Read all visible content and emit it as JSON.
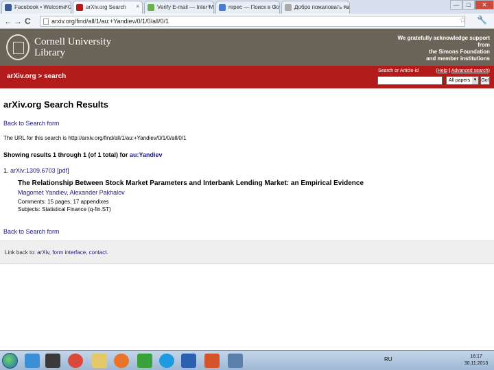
{
  "browser": {
    "tabs": [
      {
        "label": "Facebook • Welcome Google",
        "icon_color": "#3b5998"
      },
      {
        "label": "arXiv.org Search",
        "icon_color": "#b31b1b",
        "active": true
      },
      {
        "label": "Verify E-mail — Inter Medi",
        "icon_color": "#6ab04c"
      },
      {
        "label": "repec — Поиск в Google",
        "icon_color": "#4a7bd0"
      },
      {
        "label": "Добро пожаловать на с",
        "icon_color": "#aaaaaa"
      }
    ],
    "tab_close": "×",
    "window": {
      "minimize": "—",
      "maximize": "□",
      "close": "✕"
    },
    "back": "←",
    "forward": "→",
    "reload": "C",
    "url": "arxiv.org/find/all/1/au:+Yandiev/0/1/0/all/0/1",
    "star": "☆",
    "wrench": "🔧"
  },
  "header": {
    "institution_line1": "Cornell University",
    "institution_line2": "Library",
    "support_line1": "We gratefully acknowledge support from",
    "support_line2": "the Simons Foundation",
    "support_line3": "and member institutions"
  },
  "redbar": {
    "breadcrumb": "arXiv.org > search",
    "search_label": "Search or Article-id",
    "help": "Help",
    "separator": "|",
    "advanced": "Advanced search",
    "search_value": "",
    "select_value": "All papers",
    "select_arrow": "▼",
    "go_label": "Go!"
  },
  "main": {
    "title": "arXiv.org Search Results",
    "back_link": "Back to Search form",
    "url_text": "The URL for this search is http://arxiv.org/find/all/1/au:+Yandiev/0/1/0/all/0/1",
    "showing_prefix": "Showing results 1 through 1 (of 1 total) for",
    "showing_query": "au:Yandiev",
    "result": {
      "number": "1.",
      "arxiv_id": "arXiv:1309.6703",
      "pdf": "[pdf]",
      "title": "The Relationship Between Stock Market Parameters and Interbank Lending Market: an Empirical Evidence",
      "authors": "Magomet Yandiev, Alexander Pakhalov",
      "comments": "Comments: 15 pages, 17 appendixes",
      "subjects": "Subjects: Statistical Finance (q-fin.ST)"
    },
    "back_link_bottom": "Back to Search form"
  },
  "footer": {
    "prefix": "Link back to:",
    "link1": "arXiv",
    "comma1": ",",
    "link2": "form interface",
    "comma2": ",",
    "link3": "contact",
    "suffix": "."
  },
  "taskbar": {
    "icons": [
      {
        "name": "internet-explorer-icon",
        "color": "#3a8fd6"
      },
      {
        "name": "media-player-icon",
        "color": "#3a3a3a"
      },
      {
        "name": "chrome-icon",
        "color": "#d94a3a"
      },
      {
        "name": "folder-icon",
        "color": "#e4c86a"
      },
      {
        "name": "firefox-icon",
        "color": "#e8742a"
      },
      {
        "name": "clover-icon",
        "color": "#3aa23a"
      },
      {
        "name": "skype-icon",
        "color": "#1e9be0"
      },
      {
        "name": "word-icon",
        "color": "#2d5fb0"
      },
      {
        "name": "powerpoint-icon",
        "color": "#d4542c"
      },
      {
        "name": "picture-icon",
        "color": "#5a7fa8"
      }
    ],
    "language": "RU",
    "time": "16:17",
    "date": "30.11.2013"
  },
  "colors": {
    "arxiv_red": "#b31b1b",
    "cornell_gray": "#6b6559",
    "link": "#1d1a7a"
  }
}
